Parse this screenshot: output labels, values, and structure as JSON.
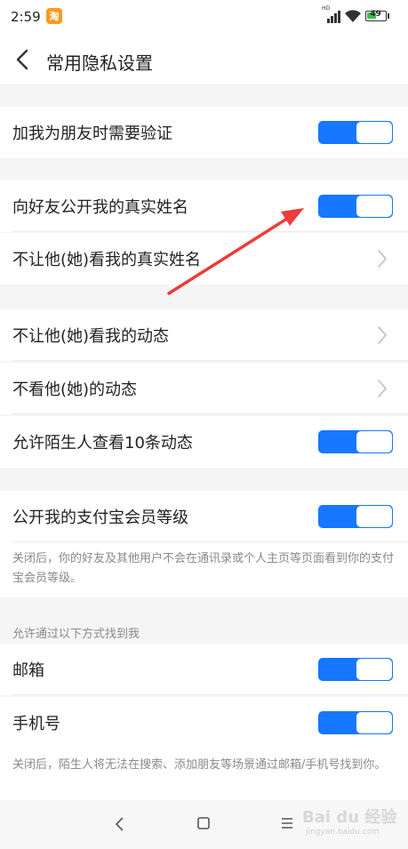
{
  "status_bar": {
    "time": "2:59",
    "app_badge": "淘",
    "network_label": "HD",
    "battery_level": "49"
  },
  "header": {
    "title": "常用隐私设置",
    "back_icon": "chevron-left-icon"
  },
  "settings": {
    "add_friend_verify": {
      "label": "加我为朋友时需要验证",
      "enabled": true
    },
    "show_real_name": {
      "label": "向好友公开我的真实姓名",
      "enabled": true
    },
    "hide_real_name_from": {
      "label": "不让他(她)看我的真实姓名"
    },
    "hide_moments_from": {
      "label": "不让他(她)看我的动态"
    },
    "dont_view_moments": {
      "label": "不看他(她)的动态"
    },
    "stranger_view_moments": {
      "label": "允许陌生人查看10条动态",
      "enabled": true
    },
    "show_member_level": {
      "label": "公开我的支付宝会员等级",
      "enabled": true
    },
    "member_level_note": "关闭后，你的好友及其他用户不会在通讯录或个人主页等页面看到你的支付宝会员等级。",
    "find_me_header": "允许通过以下方式找到我",
    "find_by_email": {
      "label": "邮箱",
      "enabled": true
    },
    "find_by_phone": {
      "label": "手机号",
      "enabled": true
    },
    "find_me_note": "关闭后，陌生人将无法在搜索、添加朋友等场景通过邮箱/手机号找到你。"
  },
  "bottom_nav": {
    "back_icon": "back-triangle-icon",
    "home_icon": "home-square-icon",
    "menu_icon": "menu-lines-icon"
  },
  "annotation": {
    "color": "#ee3b3b"
  },
  "watermark": {
    "logo": "Bai du 经验",
    "url": "jingyan.baidu.com"
  },
  "colors": {
    "accent": "#1677ff",
    "background": "#f5f5f5",
    "secondary_text": "#8a8a8a"
  }
}
